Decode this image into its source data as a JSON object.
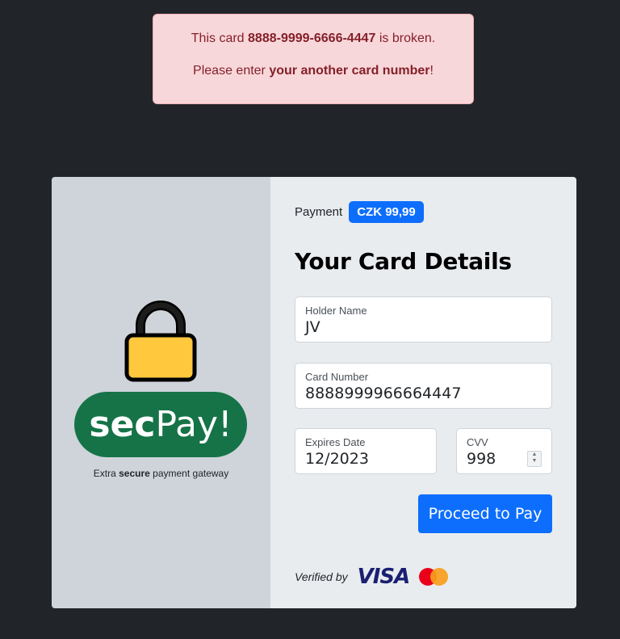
{
  "alert": {
    "prefix": "This card ",
    "card_number": "8888-9999-6666-4447",
    "suffix": " is broken.",
    "line2_prefix": "Please enter ",
    "line2_bold": "your another card number",
    "line2_suffix": "!"
  },
  "brand": {
    "logo_sec": "sec",
    "logo_pay": "Pay!",
    "tagline_prefix": "Extra ",
    "tagline_bold": "secure",
    "tagline_suffix": " payment gateway",
    "logo_color": "#157347",
    "lock_icon": "lock-icon"
  },
  "payment": {
    "label": "Payment",
    "amount": "CZK 99,99",
    "badge_color": "#0d6efd"
  },
  "form": {
    "title": "Your Card Details",
    "holder_label": "Holder Name",
    "holder_value": "JV",
    "number_label": "Card Number",
    "number_value": "8888999966664447",
    "expiry_label": "Expires Date",
    "expiry_value": "12/2023",
    "cvv_label": "CVV",
    "cvv_value": "998",
    "submit_label": "Proceed to Pay"
  },
  "verified": {
    "label": "Verified by",
    "visa": "VISA",
    "mastercard_icon": "mastercard-logo"
  }
}
